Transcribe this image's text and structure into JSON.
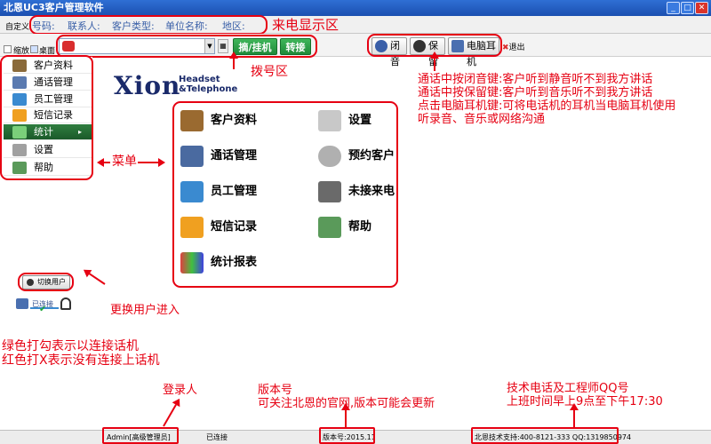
{
  "window": {
    "title": "北恩UC3客户管理软件"
  },
  "menubar": {
    "customize": "自定义",
    "fields": [
      "号码:",
      "联系人:",
      "客户类型:",
      "单位名称:",
      "地区:"
    ]
  },
  "toolbar": {
    "shrink": "缩放",
    "desktop": "桌面",
    "answer_hangup": "摘/挂机",
    "transfer": "转接",
    "mute": "闭音",
    "hold": "保留",
    "pc_headset": "电脑耳机",
    "exit": "退出"
  },
  "sidebar": {
    "items": [
      "客户资料",
      "通话管理",
      "员工管理",
      "短信记录",
      "统计",
      "设置",
      "帮助"
    ],
    "active_index": 4
  },
  "logo": {
    "brand": "Xion",
    "sub1": "Headset",
    "sub2": "&Telephone"
  },
  "main_menu": {
    "items": [
      "客户资料",
      "设置",
      "通话管理",
      "预约客户",
      "员工管理",
      "未接来电",
      "短信记录",
      "帮助",
      "统计报表"
    ]
  },
  "user": {
    "switch_user": "切换用户",
    "connected": "已连接"
  },
  "status": {
    "login": "Admin[高级管理员]",
    "connection": "已连接",
    "version": "版本号:2015.11",
    "support": "北恩技术支持:400-8121-333 QQ:1319850974"
  },
  "annotations": {
    "caller_display": "来电显示区",
    "dial_area": "拨号区",
    "buttons_help": [
      "通话中按闭音键:客户听到静音听不到我方讲话",
      "通话中按保留键:客户听到音乐听不到我方讲话",
      "点击电脑耳机键:可将电话机的耳机当电脑耳机使用",
      "听录音、音乐或网络沟通"
    ],
    "menu": "菜单",
    "switch_user": "更换用户进入",
    "connection_help": [
      "绿色打勾表示以连接话机",
      "红色打X表示没有连接上话机"
    ],
    "login_user": "登录人",
    "version": "版本号",
    "version_help": "可关注北恩的官网,版本可能会更新",
    "support": "技术电话及工程师QQ号",
    "hours": "上班时间早上9点至下午17:30"
  },
  "colors": {
    "accent_red": "#e60012",
    "titlebar": "#1b4fb0",
    "green": "#1f8a3a"
  }
}
